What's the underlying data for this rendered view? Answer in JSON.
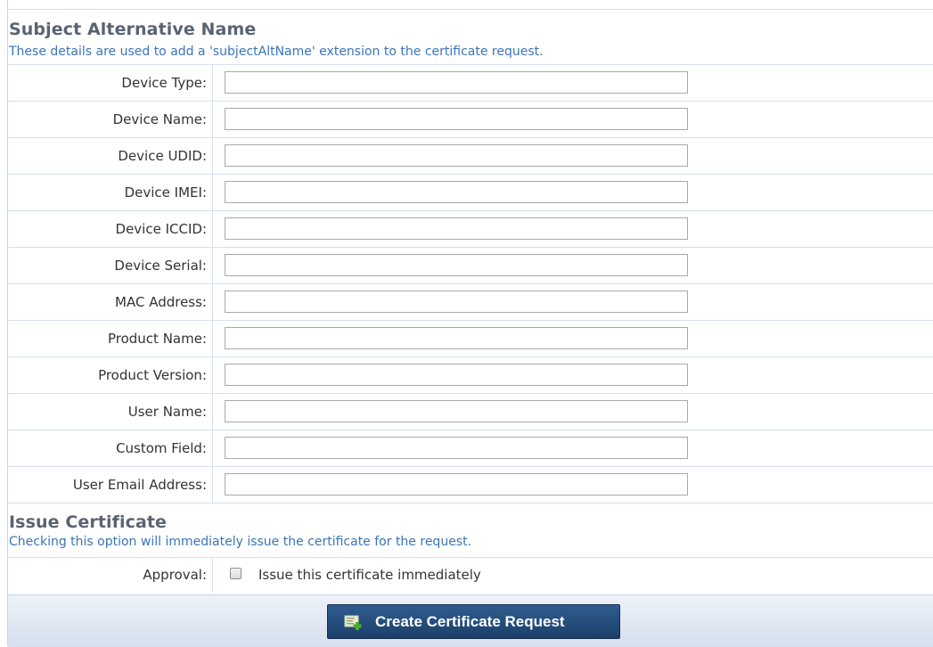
{
  "san_section": {
    "title": "Subject Alternative Name",
    "description": "These details are used to add a 'subjectAltName' extension to the certificate request."
  },
  "fields": [
    {
      "label": "Device Type:",
      "value": ""
    },
    {
      "label": "Device Name:",
      "value": ""
    },
    {
      "label": "Device UDID:",
      "value": ""
    },
    {
      "label": "Device IMEI:",
      "value": ""
    },
    {
      "label": "Device ICCID:",
      "value": ""
    },
    {
      "label": "Device Serial:",
      "value": ""
    },
    {
      "label": "MAC Address:",
      "value": ""
    },
    {
      "label": "Product Name:",
      "value": ""
    },
    {
      "label": "Product Version:",
      "value": ""
    },
    {
      "label": "User Name:",
      "value": ""
    },
    {
      "label": "Custom Field:",
      "value": ""
    },
    {
      "label": "User Email Address:",
      "value": ""
    }
  ],
  "issue_section": {
    "title": "Issue Certificate",
    "description": "Checking this option will immediately issue the certificate for the request."
  },
  "approval": {
    "label": "Approval:",
    "checkbox_label": "Issue this certificate immediately",
    "checked": false
  },
  "submit": {
    "label": "Create Certificate Request",
    "icon": "certificate-add-icon"
  },
  "colors": {
    "accent_text": "#3a75b8",
    "button": "#1f4470"
  }
}
